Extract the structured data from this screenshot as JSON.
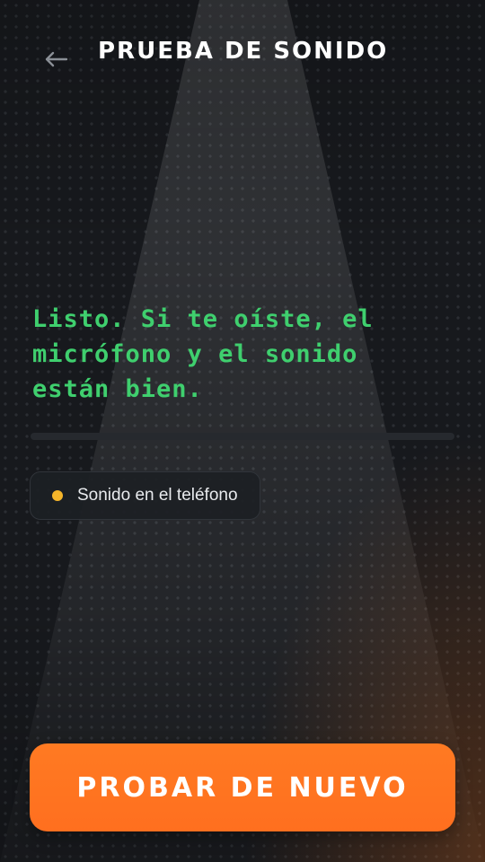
{
  "header": {
    "back_icon": "arrow-left-icon",
    "title": "PRUEBA DE SONIDO"
  },
  "main": {
    "status_message": "Listo. Si te oíste, el micrófono y el sonido están bien.",
    "output_chip": {
      "label": "Sonido en el teléfono",
      "dot_color": "#f5b52a"
    }
  },
  "footer": {
    "retry_label": "PROBAR DE NUEVO"
  },
  "colors": {
    "accent": "#ff6f1f",
    "success": "#3fcf6e",
    "background": "#17191d"
  }
}
